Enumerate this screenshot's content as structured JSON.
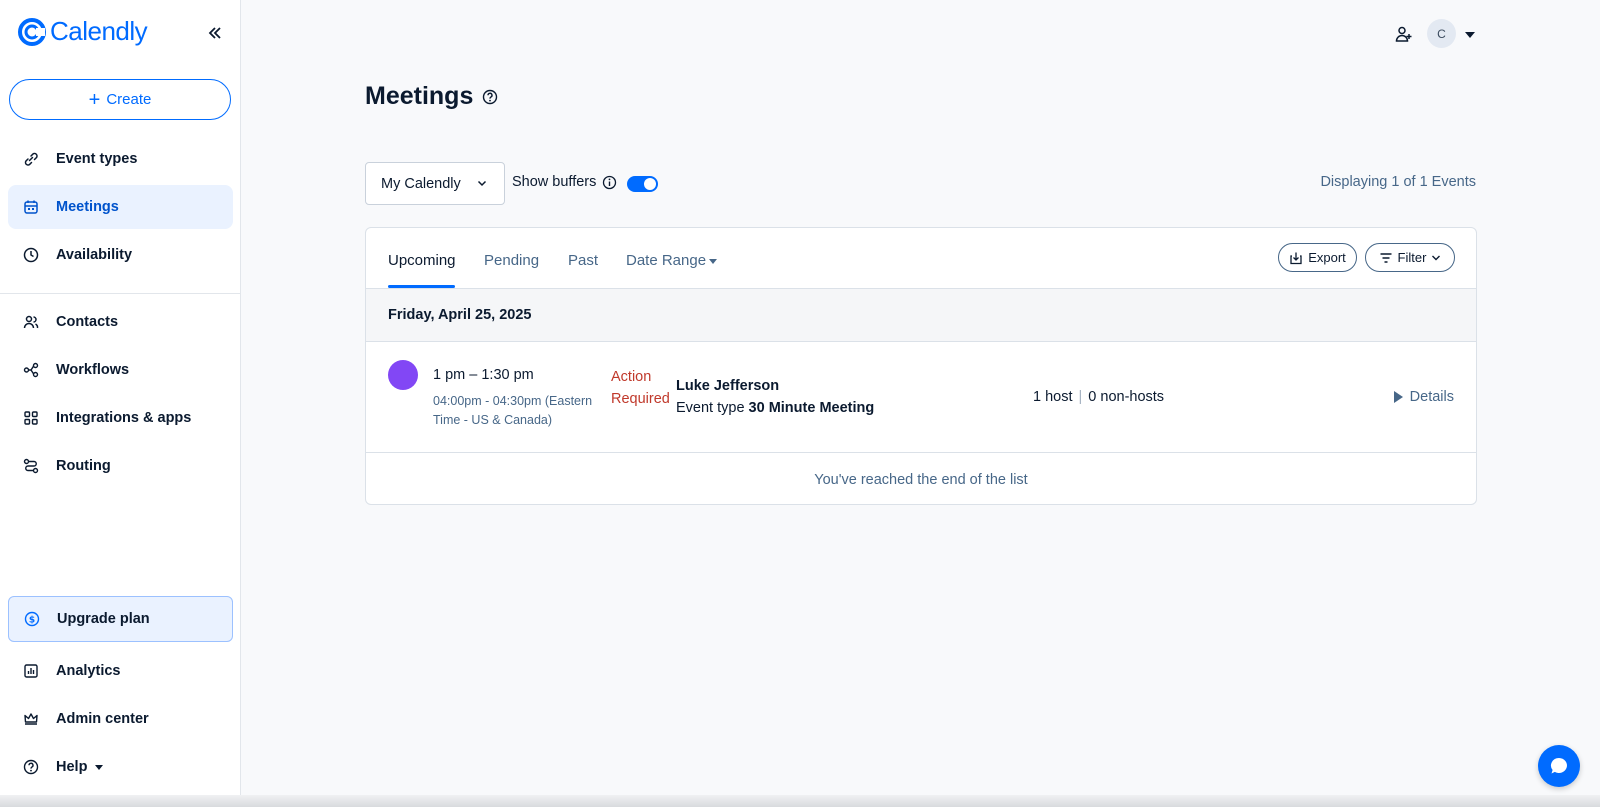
{
  "app": {
    "name": "Calendly",
    "brand_color": "#006bff"
  },
  "sidebar": {
    "create_label": "Create",
    "items": [
      {
        "label": "Event types",
        "icon": "link-icon"
      },
      {
        "label": "Meetings",
        "icon": "calendar-icon",
        "active": true
      },
      {
        "label": "Availability",
        "icon": "clock-icon"
      },
      {
        "label": "Contacts",
        "icon": "contacts-icon"
      },
      {
        "label": "Workflows",
        "icon": "workflows-icon"
      },
      {
        "label": "Integrations & apps",
        "icon": "grid-icon"
      },
      {
        "label": "Routing",
        "icon": "routing-icon"
      }
    ],
    "upgrade_label": "Upgrade plan",
    "bottom_items": [
      {
        "label": "Analytics",
        "icon": "chart-icon"
      },
      {
        "label": "Admin center",
        "icon": "crown-icon"
      },
      {
        "label": "Help",
        "icon": "help-icon"
      }
    ]
  },
  "header": {
    "avatar_initial": "C"
  },
  "page": {
    "title": "Meetings",
    "calendar_select": "My Calendly",
    "show_buffers_label": "Show buffers",
    "show_buffers_on": true,
    "displaying_text": "Displaying 1 of 1 Events"
  },
  "tabs": [
    {
      "label": "Upcoming",
      "active": true
    },
    {
      "label": "Pending"
    },
    {
      "label": "Past"
    },
    {
      "label": "Date Range"
    }
  ],
  "actions": {
    "export_label": "Export",
    "filter_label": "Filter"
  },
  "events": {
    "date_header": "Friday, April 25, 2025",
    "items": [
      {
        "time": "1 pm – 1:30 pm",
        "tz_time": "04:00pm - 04:30pm (Eastern Time - US & Canada)",
        "status": "Action Required",
        "invitee": "Luke Jefferson",
        "event_type_prefix": "Event type",
        "event_type": "30 Minute Meeting",
        "hosts": "1 host",
        "non_hosts": "0 non-hosts",
        "details_label": "Details",
        "color": "#8247f5"
      }
    ],
    "end_text": "You've reached the end of the list"
  }
}
